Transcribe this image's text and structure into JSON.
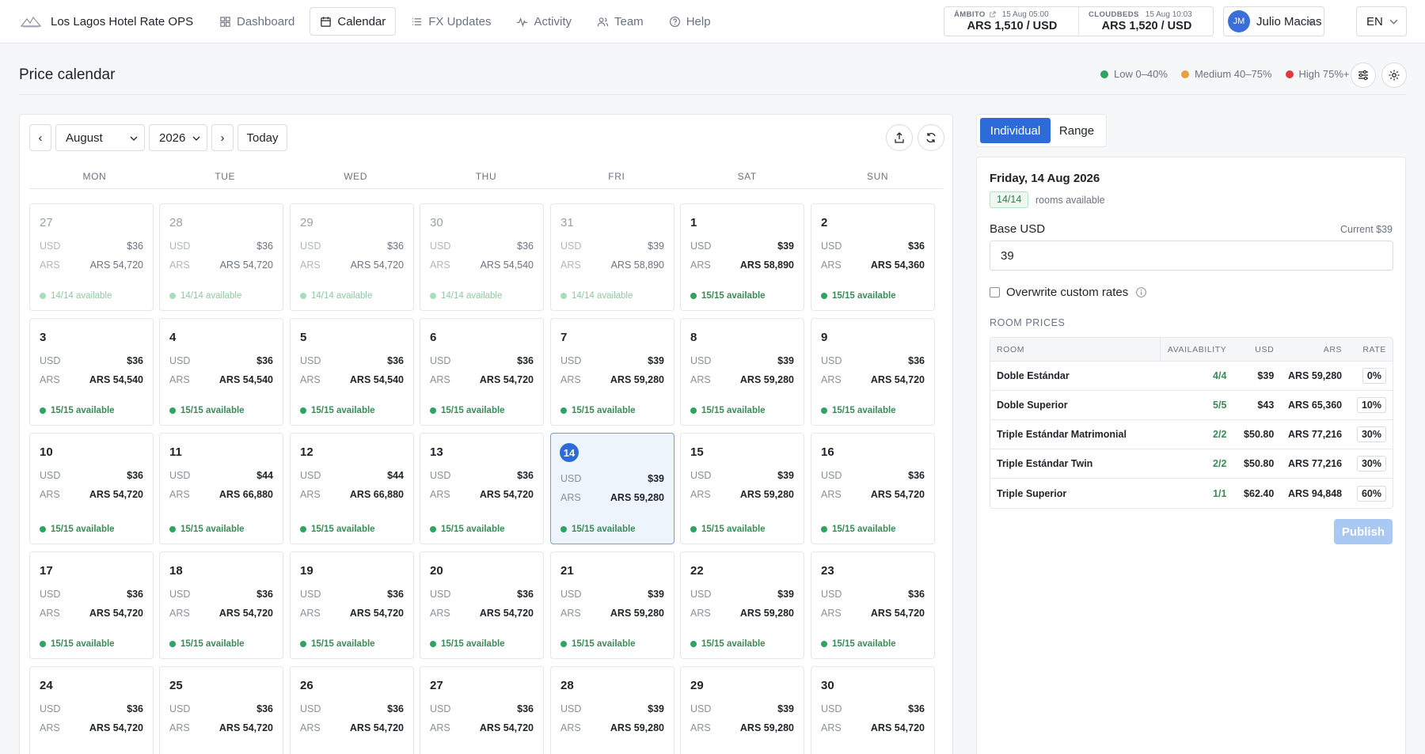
{
  "app": {
    "title": "Los Lagos Hotel Rate OPS"
  },
  "nav": [
    {
      "key": "dashboard",
      "label": "Dashboard",
      "icon": "grid-icon",
      "active": false
    },
    {
      "key": "calendar",
      "label": "Calendar",
      "icon": "calendar-icon",
      "active": true
    },
    {
      "key": "fx-updates",
      "label": "FX Updates",
      "icon": "list-icon",
      "active": false
    },
    {
      "key": "activity",
      "label": "Activity",
      "icon": "activity-icon",
      "active": false
    },
    {
      "key": "team",
      "label": "Team",
      "icon": "users-icon",
      "active": false
    },
    {
      "key": "help",
      "label": "Help",
      "icon": "help-circle-icon",
      "active": false
    }
  ],
  "fx": [
    {
      "source": "ÁMBITO",
      "timestamp": "15 Aug 05:00",
      "value": "ARS 1,510 / USD",
      "external_link": true
    },
    {
      "source": "CLOUDBEDS",
      "timestamp": "15 Aug 10:03",
      "value": "ARS 1,520 / USD",
      "external_link": false
    }
  ],
  "user": {
    "initials": "JM",
    "name": "Julio Macias"
  },
  "language": "EN",
  "page": {
    "title": "Price calendar"
  },
  "legend": [
    {
      "label": "Low 0–40%",
      "color": "#2fa362"
    },
    {
      "label": "Medium 40–75%",
      "color": "#e9a23b"
    },
    {
      "label": "High 75%+",
      "color": "#e0393e"
    }
  ],
  "toolbar": {
    "prev": "‹",
    "next": "›",
    "month": "August",
    "year": "2026",
    "today": "Today"
  },
  "weekdays": [
    "MON",
    "TUE",
    "WED",
    "THU",
    "FRI",
    "SAT",
    "SUN"
  ],
  "currency_labels": {
    "usd": "USD",
    "ars": "ARS"
  },
  "calendar": {
    "selected_day": 14,
    "days": [
      {
        "day": "27",
        "usd": "$36",
        "ars": "ARS 54,720",
        "avail": "14/14 available",
        "muted": true
      },
      {
        "day": "28",
        "usd": "$36",
        "ars": "ARS 54,720",
        "avail": "14/14 available",
        "muted": true
      },
      {
        "day": "29",
        "usd": "$36",
        "ars": "ARS 54,720",
        "avail": "14/14 available",
        "muted": true
      },
      {
        "day": "30",
        "usd": "$36",
        "ars": "ARS 54,540",
        "avail": "14/14 available",
        "muted": true
      },
      {
        "day": "31",
        "usd": "$39",
        "ars": "ARS 58,890",
        "avail": "14/14 available",
        "muted": true
      },
      {
        "day": "1",
        "usd": "$39",
        "ars": "ARS 58,890",
        "avail": "15/15 available"
      },
      {
        "day": "2",
        "usd": "$36",
        "ars": "ARS 54,360",
        "avail": "15/15 available"
      },
      {
        "day": "3",
        "usd": "$36",
        "ars": "ARS 54,540",
        "avail": "15/15 available"
      },
      {
        "day": "4",
        "usd": "$36",
        "ars": "ARS 54,540",
        "avail": "15/15 available"
      },
      {
        "day": "5",
        "usd": "$36",
        "ars": "ARS 54,540",
        "avail": "15/15 available"
      },
      {
        "day": "6",
        "usd": "$36",
        "ars": "ARS 54,720",
        "avail": "15/15 available"
      },
      {
        "day": "7",
        "usd": "$39",
        "ars": "ARS 59,280",
        "avail": "15/15 available"
      },
      {
        "day": "8",
        "usd": "$39",
        "ars": "ARS 59,280",
        "avail": "15/15 available"
      },
      {
        "day": "9",
        "usd": "$36",
        "ars": "ARS 54,720",
        "avail": "15/15 available"
      },
      {
        "day": "10",
        "usd": "$36",
        "ars": "ARS 54,720",
        "avail": "15/15 available"
      },
      {
        "day": "11",
        "usd": "$44",
        "ars": "ARS 66,880",
        "avail": "15/15 available"
      },
      {
        "day": "12",
        "usd": "$44",
        "ars": "ARS 66,880",
        "avail": "15/15 available"
      },
      {
        "day": "13",
        "usd": "$36",
        "ars": "ARS 54,720",
        "avail": "15/15 available"
      },
      {
        "day": "14",
        "usd": "$39",
        "ars": "ARS 59,280",
        "avail": "15/15 available",
        "selected": true
      },
      {
        "day": "15",
        "usd": "$39",
        "ars": "ARS 59,280",
        "avail": "15/15 available"
      },
      {
        "day": "16",
        "usd": "$36",
        "ars": "ARS 54,720",
        "avail": "15/15 available"
      },
      {
        "day": "17",
        "usd": "$36",
        "ars": "ARS 54,720",
        "avail": "15/15 available"
      },
      {
        "day": "18",
        "usd": "$36",
        "ars": "ARS 54,720",
        "avail": "15/15 available"
      },
      {
        "day": "19",
        "usd": "$36",
        "ars": "ARS 54,720",
        "avail": "15/15 available"
      },
      {
        "day": "20",
        "usd": "$36",
        "ars": "ARS 54,720",
        "avail": "15/15 available"
      },
      {
        "day": "21",
        "usd": "$39",
        "ars": "ARS 59,280",
        "avail": "15/15 available"
      },
      {
        "day": "22",
        "usd": "$39",
        "ars": "ARS 59,280",
        "avail": "15/15 available"
      },
      {
        "day": "23",
        "usd": "$36",
        "ars": "ARS 54,720",
        "avail": "15/15 available"
      },
      {
        "day": "24",
        "usd": "$36",
        "ars": "ARS 54,720",
        "avail": ""
      },
      {
        "day": "25",
        "usd": "$36",
        "ars": "ARS 54,720",
        "avail": ""
      },
      {
        "day": "26",
        "usd": "$36",
        "ars": "ARS 54,720",
        "avail": ""
      },
      {
        "day": "27",
        "usd": "$36",
        "ars": "ARS 54,720",
        "avail": ""
      },
      {
        "day": "28",
        "usd": "$39",
        "ars": "ARS 59,280",
        "avail": ""
      },
      {
        "day": "29",
        "usd": "$39",
        "ars": "ARS 59,280",
        "avail": ""
      },
      {
        "day": "30",
        "usd": "$36",
        "ars": "ARS 54,720",
        "avail": ""
      }
    ]
  },
  "mode_tabs": {
    "individual": "Individual",
    "range": "Range"
  },
  "side": {
    "date": "Friday, 14 Aug 2026",
    "rooms_badge": "14/14",
    "rooms_label": "rooms available",
    "base_label": "Base USD",
    "current": "Current $39",
    "base_value": "39",
    "overwrite_label": "Overwrite custom rates",
    "section_title": "ROOM PRICES",
    "columns": [
      "ROOM",
      "AVAILABILITY",
      "USD",
      "ARS",
      "RATE"
    ],
    "rooms": [
      {
        "name": "Doble Estándar",
        "availability": "4/4",
        "usd": "$39",
        "ars": "ARS 59,280",
        "rate": "0%"
      },
      {
        "name": "Doble Superior",
        "availability": "5/5",
        "usd": "$43",
        "ars": "ARS 65,360",
        "rate": "10%"
      },
      {
        "name": "Triple Estándar Matrimonial",
        "availability": "2/2",
        "usd": "$50.80",
        "ars": "ARS 77,216",
        "rate": "30%"
      },
      {
        "name": "Triple Estándar Twin",
        "availability": "2/2",
        "usd": "$50.80",
        "ars": "ARS 77,216",
        "rate": "30%"
      },
      {
        "name": "Triple Superior",
        "availability": "1/1",
        "usd": "$62.40",
        "ars": "ARS 94,848",
        "rate": "60%"
      }
    ],
    "publish_label": "Publish"
  }
}
